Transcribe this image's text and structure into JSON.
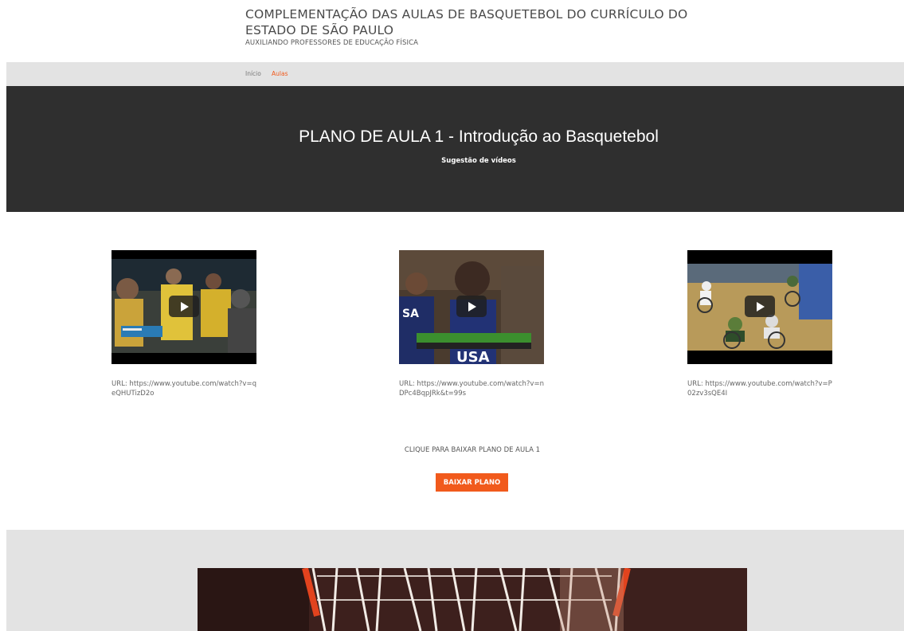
{
  "header": {
    "title": "COMPLEMENTAÇÃO DAS AULAS DE BASQUETEBOL DO CURRÍCULO DO ESTADO DE SÃO PAULO",
    "subtitle": "AUXILIANDO PROFESSORES DE EDUCAÇÃO FÍSICA"
  },
  "nav": {
    "items": [
      {
        "label": "Início",
        "active": false
      },
      {
        "label": "Aulas",
        "active": true
      }
    ]
  },
  "hero": {
    "title": "PLANO DE AULA 1 - Introdução ao Basquetebol",
    "subtitle": "Sugestão de vídeos"
  },
  "videos": [
    {
      "url_text": "URL: https://www.youtube.com/watch?v=qeQHUTizD2o",
      "icon": "play-icon"
    },
    {
      "url_text": "URL: https://www.youtube.com/watch?v=nDPc4BqpJRk&t=99s",
      "icon": "play-icon"
    },
    {
      "url_text": "URL: https://www.youtube.com/watch?v=P02zv3sQE4I",
      "icon": "play-icon"
    }
  ],
  "download": {
    "label": "CLIQUE PARA BAIXAR PLANO DE AULA 1",
    "button": "BAIXAR PLANO"
  },
  "colors": {
    "accent": "#f15a1c",
    "hero_bg": "#2f2f2f",
    "nav_bg": "#e3e3e3"
  }
}
